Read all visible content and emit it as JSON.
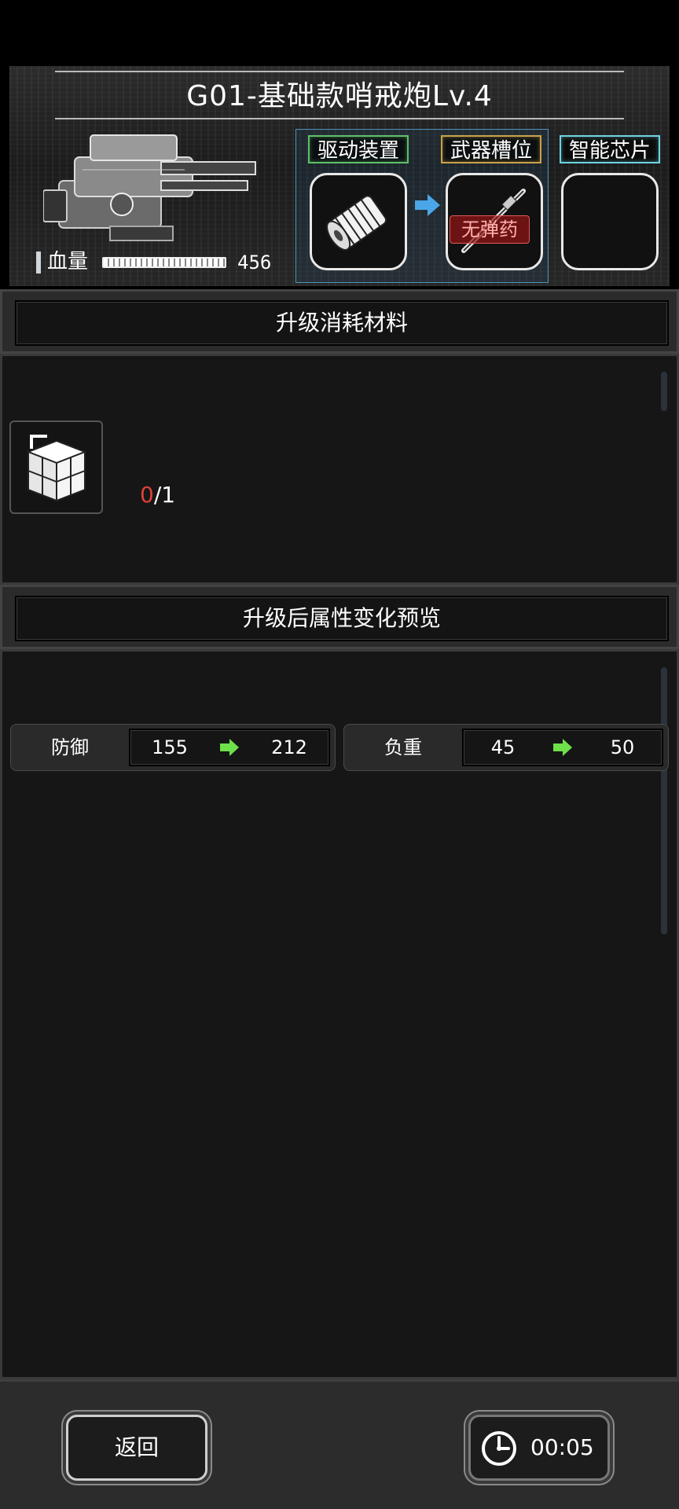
{
  "header": {
    "title": "G01-基础款哨戒炮Lv.4",
    "hp_label": "血量",
    "hp_value": "456",
    "slots": {
      "drive": {
        "label": "驱动装置",
        "icon": "drive-cylinder-icon",
        "color": "#5fbf6a"
      },
      "weapon": {
        "label": "武器槽位",
        "icon": "gun-barrel-icon",
        "status": "无弹药",
        "color": "#c9a24a"
      },
      "chip": {
        "label": "智能芯片",
        "color": "#6fd2e0"
      }
    }
  },
  "materials": {
    "title": "升级消耗材料",
    "items": [
      {
        "icon": "material-crate-icon",
        "have": "0",
        "need": "/1"
      }
    ]
  },
  "preview": {
    "title": "升级后属性变化预览",
    "stats": [
      {
        "name": "防御",
        "from": "155",
        "to": "212"
      },
      {
        "name": "负重",
        "from": "45",
        "to": "50"
      }
    ]
  },
  "footer": {
    "back_label": "返回",
    "timer": "00:05"
  }
}
